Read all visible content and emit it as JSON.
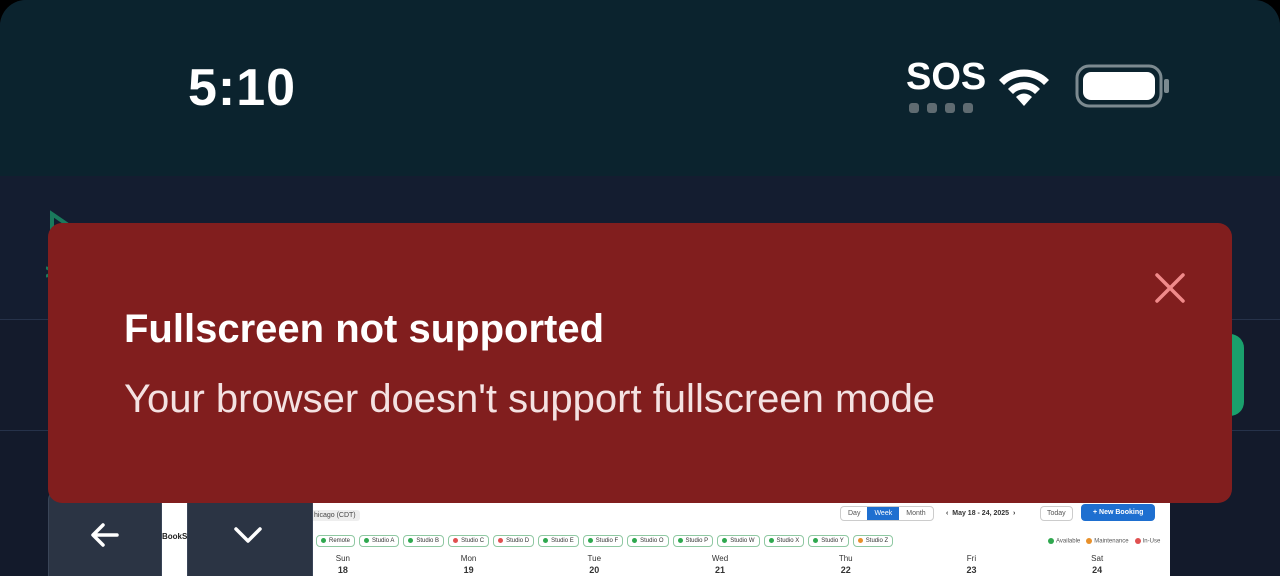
{
  "status_bar": {
    "time": "5:10",
    "carrier": "SOS",
    "icons": [
      "sos-dots-icon",
      "wifi-icon",
      "battery-icon"
    ]
  },
  "toast": {
    "title": "Fullscreen not supported",
    "message": "Your browser doesn't support fullscreen mode",
    "close_icon": "close-icon",
    "colors": {
      "background": "#811e1e",
      "close": "#f08a8a"
    }
  },
  "background_app": {
    "nav_buttons": [
      "back-arrow-icon",
      "chevron-down-icon"
    ],
    "embedded_screenshot": {
      "brand": "BookSt",
      "timezone": "hicago (CDT)",
      "view_tabs": [
        "Day",
        "Week",
        "Month"
      ],
      "active_view": "Week",
      "date_range": "May 18 - 24, 2025",
      "today_label": "Today",
      "new_booking_label": "+ New Booking",
      "filters": [
        {
          "label": "Remote",
          "color": "#2fa84f"
        },
        {
          "label": "Studio A",
          "color": "#2fa84f"
        },
        {
          "label": "Studio B",
          "color": "#2fa84f"
        },
        {
          "label": "Studio C",
          "color": "#e05050"
        },
        {
          "label": "Studio D",
          "color": "#e05050"
        },
        {
          "label": "Studio E",
          "color": "#2fa84f"
        },
        {
          "label": "Studio F",
          "color": "#2fa84f"
        },
        {
          "label": "Studio O",
          "color": "#2fa84f"
        },
        {
          "label": "Studio P",
          "color": "#2fa84f"
        },
        {
          "label": "Studio W",
          "color": "#2fa84f"
        },
        {
          "label": "Studio X",
          "color": "#2fa84f"
        },
        {
          "label": "Studio Y",
          "color": "#2fa84f"
        },
        {
          "label": "Studio Z",
          "color": "#e8902a"
        }
      ],
      "legend": [
        {
          "label": "Available",
          "color": "#2fa84f"
        },
        {
          "label": "Maintenance",
          "color": "#e8902a"
        },
        {
          "label": "In-Use",
          "color": "#e05050"
        }
      ],
      "days": [
        {
          "name": "Sun",
          "date": "18"
        },
        {
          "name": "Mon",
          "date": "19"
        },
        {
          "name": "Tue",
          "date": "20"
        },
        {
          "name": "Wed",
          "date": "21"
        },
        {
          "name": "Thu",
          "date": "22"
        },
        {
          "name": "Fri",
          "date": "23"
        },
        {
          "name": "Sat",
          "date": "24"
        }
      ]
    }
  }
}
